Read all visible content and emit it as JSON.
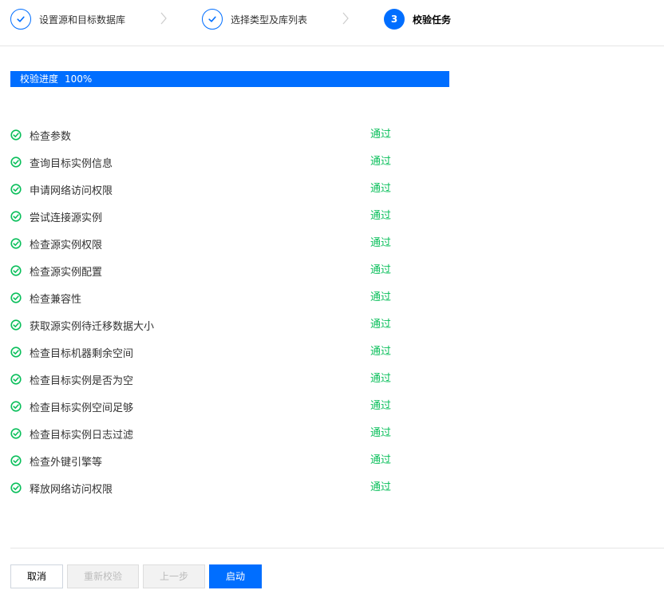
{
  "colors": {
    "primary": "#006eff",
    "success": "#0abf5b",
    "divider": "#e5e5e5"
  },
  "steps": [
    {
      "index": "1",
      "label": "设置源和目标数据库",
      "state": "done",
      "icon": "check-icon"
    },
    {
      "index": "2",
      "label": "选择类型及库列表",
      "state": "done",
      "icon": "check-icon"
    },
    {
      "index": "3",
      "label": "校验任务",
      "state": "active"
    }
  ],
  "progress": {
    "label": "校验进度",
    "value_text": "100%",
    "value": 1.0
  },
  "checks": [
    {
      "name": "检查参数",
      "status": "通过"
    },
    {
      "name": "查询目标实例信息",
      "status": "通过"
    },
    {
      "name": "申请网络访问权限",
      "status": "通过"
    },
    {
      "name": "尝试连接源实例",
      "status": "通过"
    },
    {
      "name": "检查源实例权限",
      "status": "通过"
    },
    {
      "name": "检查源实例配置",
      "status": "通过"
    },
    {
      "name": "检查兼容性",
      "status": "通过"
    },
    {
      "name": "获取源实例待迁移数据大小",
      "status": "通过"
    },
    {
      "name": "检查目标机器剩余空间",
      "status": "通过"
    },
    {
      "name": "检查目标实例是否为空",
      "status": "通过"
    },
    {
      "name": "检查目标实例空间足够",
      "status": "通过"
    },
    {
      "name": "检查目标实例日志过滤",
      "status": "通过"
    },
    {
      "name": "检查外键引擎等",
      "status": "通过"
    },
    {
      "name": "释放网络访问权限",
      "status": "通过"
    }
  ],
  "footer": {
    "cancel_label": "取消",
    "recheck_label": "重新校验",
    "prev_label": "上一步",
    "start_label": "启动"
  }
}
